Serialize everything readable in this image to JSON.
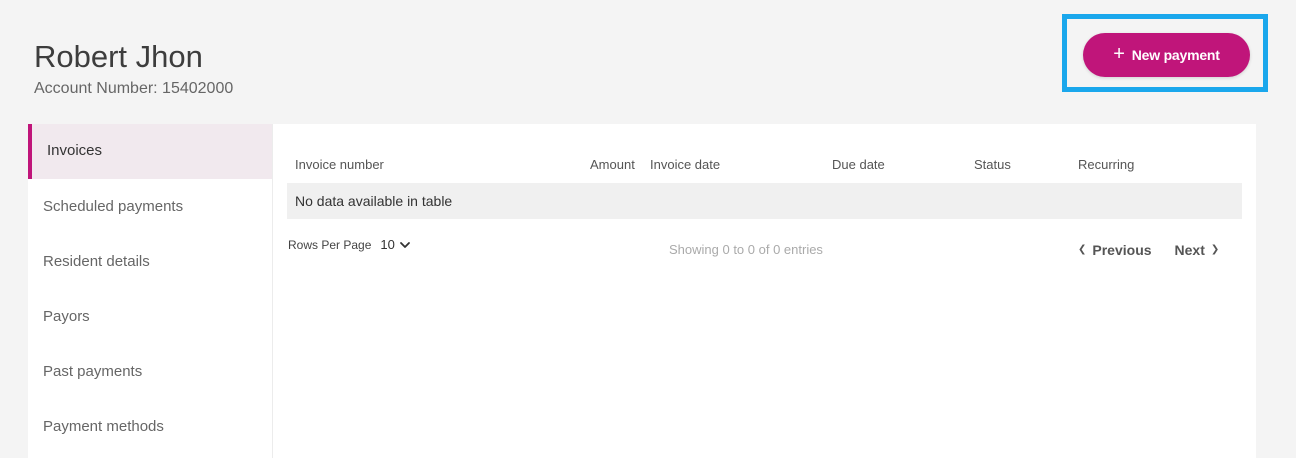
{
  "header": {
    "user_name": "Robert Jhon",
    "account_label": "Account Number: 15402000",
    "new_payment_label": "New payment",
    "new_payment_icon": "plus-icon"
  },
  "sidebar": {
    "items": [
      {
        "label": "Invoices",
        "active": true
      },
      {
        "label": "Scheduled payments",
        "active": false
      },
      {
        "label": "Resident details",
        "active": false
      },
      {
        "label": "Payors",
        "active": false
      },
      {
        "label": "Past payments",
        "active": false
      },
      {
        "label": "Payment methods",
        "active": false
      }
    ]
  },
  "table": {
    "columns": [
      "Invoice number",
      "Amount",
      "Invoice date",
      "Due date",
      "Status",
      "Recurring"
    ],
    "empty_message": "No data available in table"
  },
  "pager": {
    "rows_per_page_label": "Rows Per Page",
    "rows_per_page_value": "10",
    "showing_text": "Showing 0 to 0 of 0 entries",
    "previous_label": "Previous",
    "next_label": "Next"
  },
  "colors": {
    "accent": "#c0157a",
    "highlight": "#1aa7ec",
    "active_item_bg": "#f1e9ee",
    "page_bg": "#f4f4f4"
  }
}
